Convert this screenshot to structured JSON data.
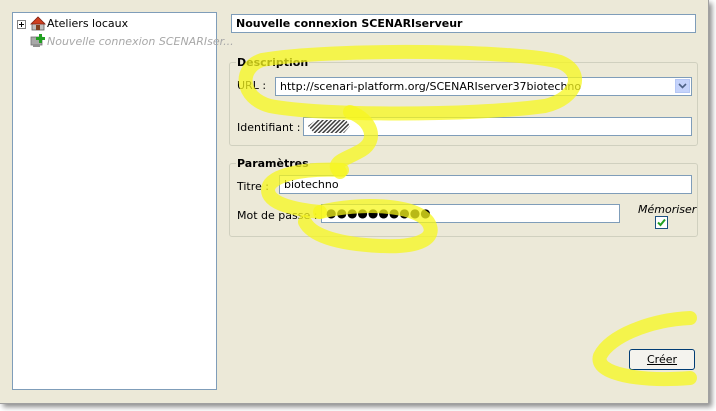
{
  "tree": {
    "items": [
      {
        "label": "Ateliers locaux",
        "expanded": false,
        "icon": "house-icon"
      },
      {
        "label": "Nouvelle connexion SCENARIser...",
        "disabled": true,
        "icon": "add-server-icon"
      }
    ]
  },
  "connection_title": "Nouvelle connexion SCENARIserveur",
  "description": {
    "heading": "Description",
    "url_label": "URL :",
    "url_value": "http://scenari-platform.org/SCENARIserver37biotechno",
    "identifier_label": "Identifiant :",
    "identifier_value": ""
  },
  "parameters": {
    "heading": "Paramètres",
    "title_label": "Titre :",
    "title_value": "biotechno",
    "password_label": "Mot de passe :",
    "password_value": "●●●●●●●●●●",
    "remember_label": "Mémoriser",
    "remember_checked": true
  },
  "create_button": "Créer",
  "colors": {
    "highlight": "#f7f71e",
    "border": "#7f9db9",
    "window_bg": "#ece9d8"
  }
}
